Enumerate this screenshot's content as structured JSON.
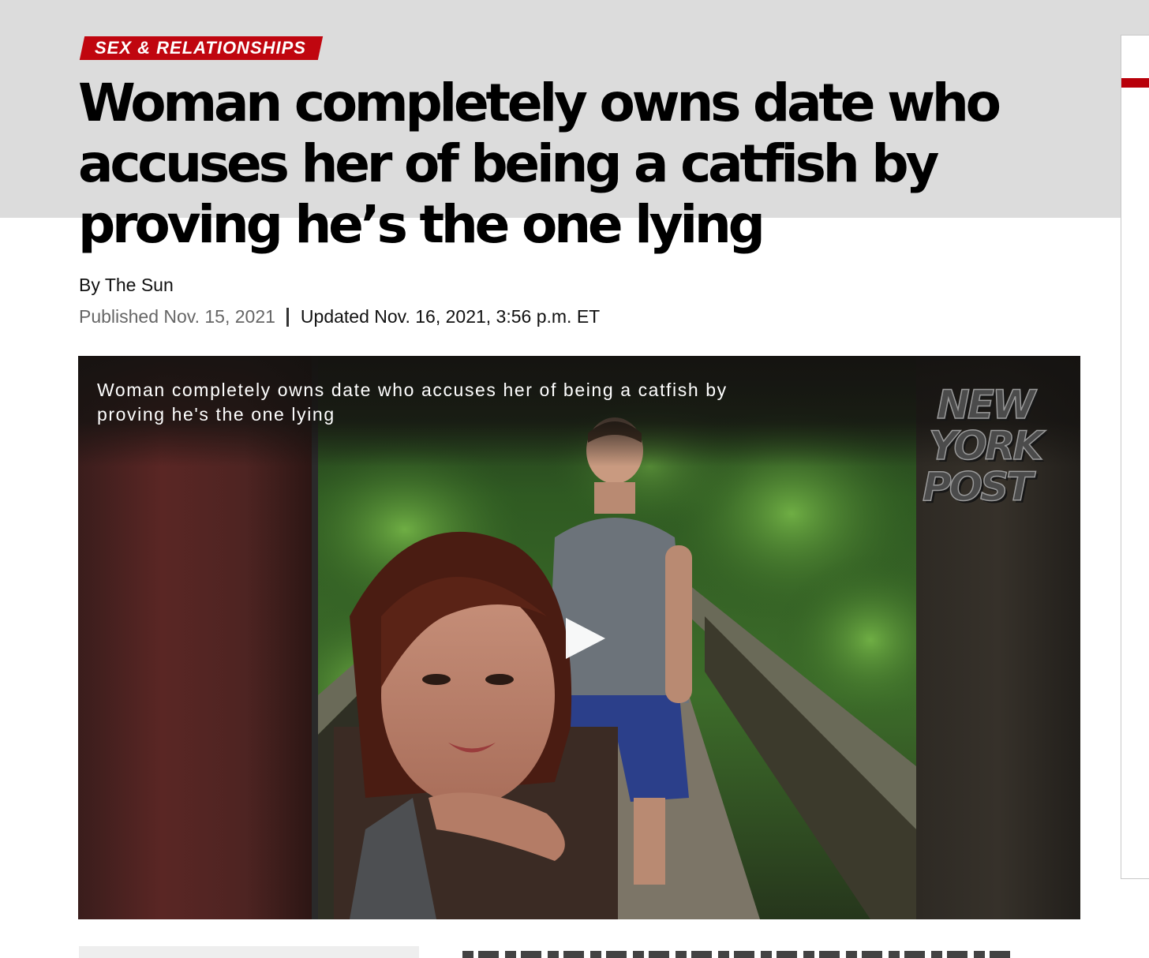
{
  "article": {
    "category": "SEX & RELATIONSHIPS",
    "headline": "Woman completely owns date who accuses her of being a catfish by proving he’s the one lying",
    "byline": "By The Sun",
    "published": "Published Nov. 15, 2021",
    "updated": "Updated Nov. 16, 2021, 3:56 p.m. ET"
  },
  "video": {
    "title": "Woman completely owns date who accuses her of being a catfish by proving he's the one lying",
    "logo_lines": [
      "NEW",
      "YORK",
      "POST"
    ],
    "play_icon": "play-icon"
  },
  "colors": {
    "accent": "#c0060f",
    "header_band": "#dcdcdc",
    "text": "#000000",
    "muted": "#666666"
  }
}
